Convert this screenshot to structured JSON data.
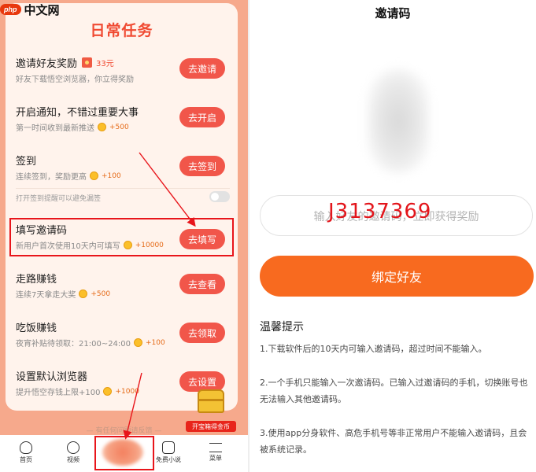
{
  "watermark": {
    "badge": "php",
    "text": "中文网"
  },
  "left": {
    "title": "日常任务",
    "tasks": [
      {
        "name": "邀请好友奖励",
        "amount": "33元",
        "desc": "好友下载悟空浏览器，你立得奖励",
        "coins": "",
        "button": "去邀请"
      },
      {
        "name": "开启通知，不错过重要大事",
        "amount": "",
        "desc": "第一时间收到最新推送",
        "coins": "+500",
        "button": "去开启"
      },
      {
        "name": "签到",
        "amount": "",
        "desc": "连续签到，奖励更高",
        "coins": "+100",
        "button": "去签到"
      },
      {
        "name": "填写邀请码",
        "amount": "",
        "desc": "新用户首次使用10天内可填写",
        "coins": "+10000",
        "button": "去填写"
      },
      {
        "name": "走路赚钱",
        "amount": "",
        "desc": "连续7天拿走大奖",
        "coins": "+500",
        "button": "去查看"
      },
      {
        "name": "吃饭赚钱",
        "amount": "",
        "desc": "夜宵补贴待领取：21:00~24:00",
        "coins": "+100",
        "button": "去领取"
      },
      {
        "name": "设置默认浏览器",
        "amount": "",
        "desc": "提升悟空存钱上限+100",
        "coins": "+1000",
        "button": "去设置"
      }
    ],
    "remind_text": "打开签到提醒可以避免漏签",
    "treasure_label": "开宝箱得金币",
    "footer_text": "— 有任何问题请反馈 —",
    "tabs": [
      {
        "label": "首页",
        "icon": "home-icon"
      },
      {
        "label": "视频",
        "icon": "video-icon"
      },
      {
        "label": "",
        "icon": "task-center-icon"
      },
      {
        "label": "免费小说",
        "icon": "novel-icon"
      },
      {
        "label": "菜单",
        "icon": "menu-icon"
      }
    ],
    "colors": {
      "accent": "#f04a32",
      "button": "#f1564a",
      "panel_bg": "#f6a98c",
      "card_bg": "#fff3ec",
      "highlight": "#e8151b"
    }
  },
  "right": {
    "title": "邀请码",
    "input_placeholder": "输入好友的邀请码，立即获得奖励",
    "input_code": "J3137369",
    "bind_button": "绑定好友",
    "tips_title": "温馨提示",
    "tips": [
      "1.下载软件后的10天内可输入邀请码，超过时间不能输入。",
      "2.一个手机只能输入一次邀请码。已输入过邀请码的手机，切换账号也无法输入其他邀请码。",
      "3.使用app分身软件、高危手机号等非正常用户不能输入邀请码，且会被系统记录。"
    ],
    "colors": {
      "bind_button": "#f86a1f",
      "code": "#e3151b"
    }
  }
}
